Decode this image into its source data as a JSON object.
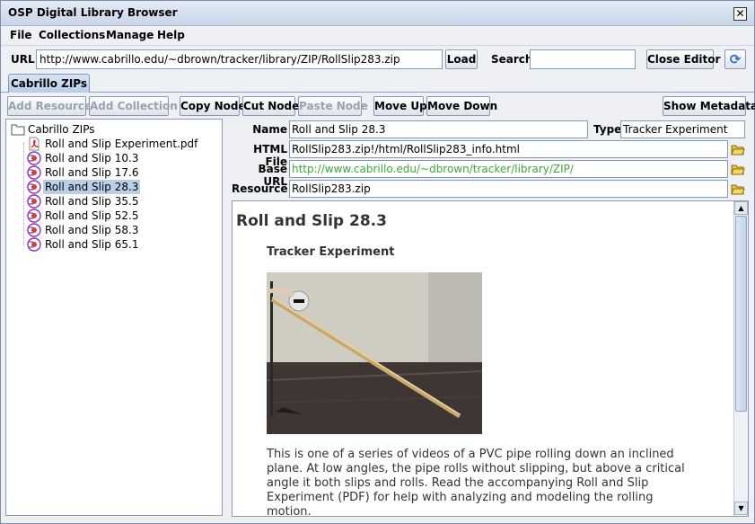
{
  "window": {
    "title": "OSP Digital Library Browser"
  },
  "menu": [
    "File",
    "Collections",
    "Manage",
    "Help"
  ],
  "urlbar": {
    "url_label": "URL:",
    "url_value": "http://www.cabrillo.edu/~dbrown/tracker/library/ZIP/RollSlip283.zip",
    "load_label": "Load",
    "search_label": "Search",
    "search_value": "",
    "close_editor_label": "Close Editor"
  },
  "tabs": [
    {
      "label": "Cabrillo ZIPs"
    }
  ],
  "toolbar": {
    "add_resource": "Add Resource",
    "add_collection": "Add Collection",
    "copy_node": "Copy Node",
    "cut_node": "Cut Node",
    "paste_node": "Paste Node",
    "move_up": "Move Up",
    "move_down": "Move Down",
    "show_metadata": "Show Metadata"
  },
  "tree": {
    "root": "Cabrillo ZIPs",
    "items": [
      {
        "label": "Roll and Slip Experiment.pdf",
        "icon": "pdf-icon"
      },
      {
        "label": "Roll and Slip 10.3",
        "icon": "tracker-icon"
      },
      {
        "label": "Roll and Slip 17.6",
        "icon": "tracker-icon"
      },
      {
        "label": "Roll and Slip 28.3",
        "icon": "tracker-icon",
        "selected": true
      },
      {
        "label": "Roll and Slip 35.5",
        "icon": "tracker-icon"
      },
      {
        "label": "Roll and Slip 52.5",
        "icon": "tracker-icon"
      },
      {
        "label": "Roll and Slip 58.3",
        "icon": "tracker-icon"
      },
      {
        "label": "Roll and Slip 65.1",
        "icon": "tracker-icon"
      }
    ]
  },
  "props": {
    "name_label": "Name",
    "name_value": "Roll and Slip 28.3",
    "type_label": "Type",
    "type_value": "Tracker Experiment",
    "html_label": "HTML File",
    "html_value": "RollSlip283.zip!/html/RollSlip283_info.html",
    "base_label": "Base URL",
    "base_value": "http://www.cabrillo.edu/~dbrown/tracker/library/ZIP/",
    "base_color": "#3aaa3a",
    "resource_label": "Resource",
    "resource_value": "RollSlip283.zip"
  },
  "doc": {
    "title": "Roll and Slip 28.3",
    "subtitle": "Tracker Experiment",
    "body": "This is one of a series of videos of a PVC pipe rolling down an inclined plane. At low angles, the pipe rolls without slipping, but above a critical angle it both slips and rolls. Read the accompanying Roll and Slip Experiment (PDF) for help with analyzing and modeling the rolling motion."
  }
}
